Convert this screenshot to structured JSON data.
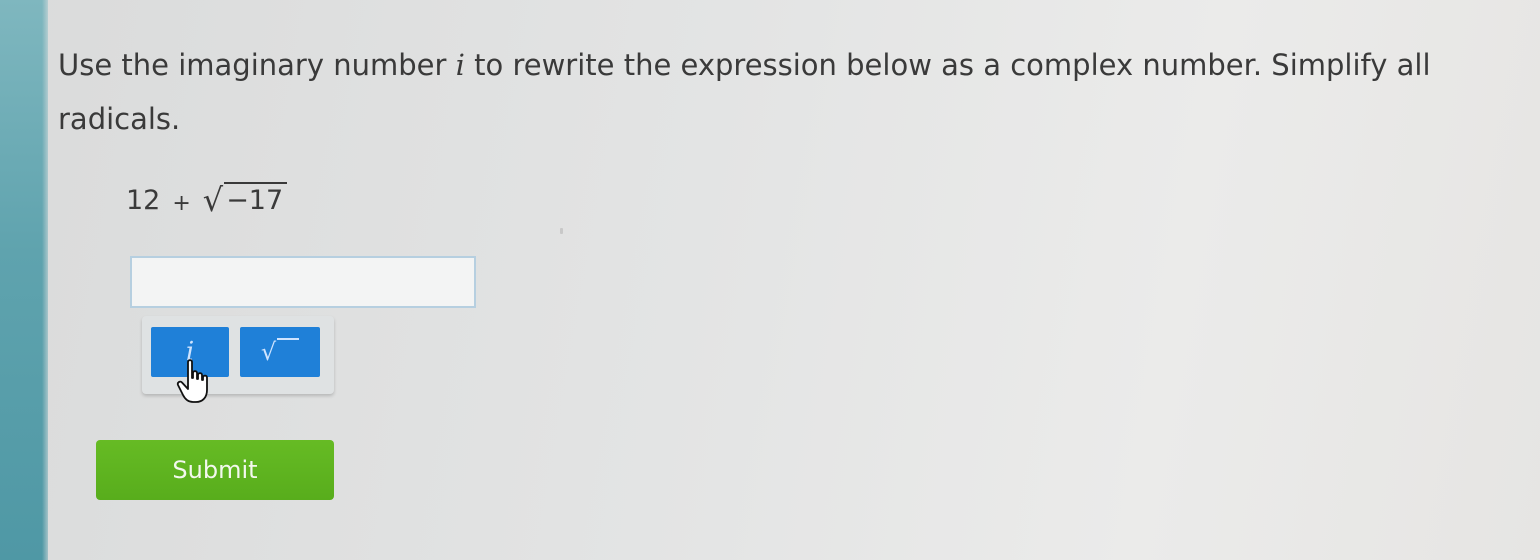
{
  "question": {
    "text_before": "Use the imaginary number ",
    "variable": "i",
    "text_after": " to rewrite the expression below as a complex number. Simplify all radicals."
  },
  "expression": {
    "constant": "12",
    "operator": "+",
    "radicand": "−17"
  },
  "answer": {
    "value": "",
    "placeholder": ""
  },
  "keypad": {
    "imaginary_label": "i",
    "sqrt_label": "√"
  },
  "submit": {
    "label": "Submit"
  },
  "colors": {
    "key_blue": "#1f80d8",
    "submit_green": "#5fb520",
    "left_strip_teal": "#5fa3ae",
    "input_border": "#b6cfe0"
  },
  "icons": {
    "cursor": "hand-pointer-icon"
  }
}
